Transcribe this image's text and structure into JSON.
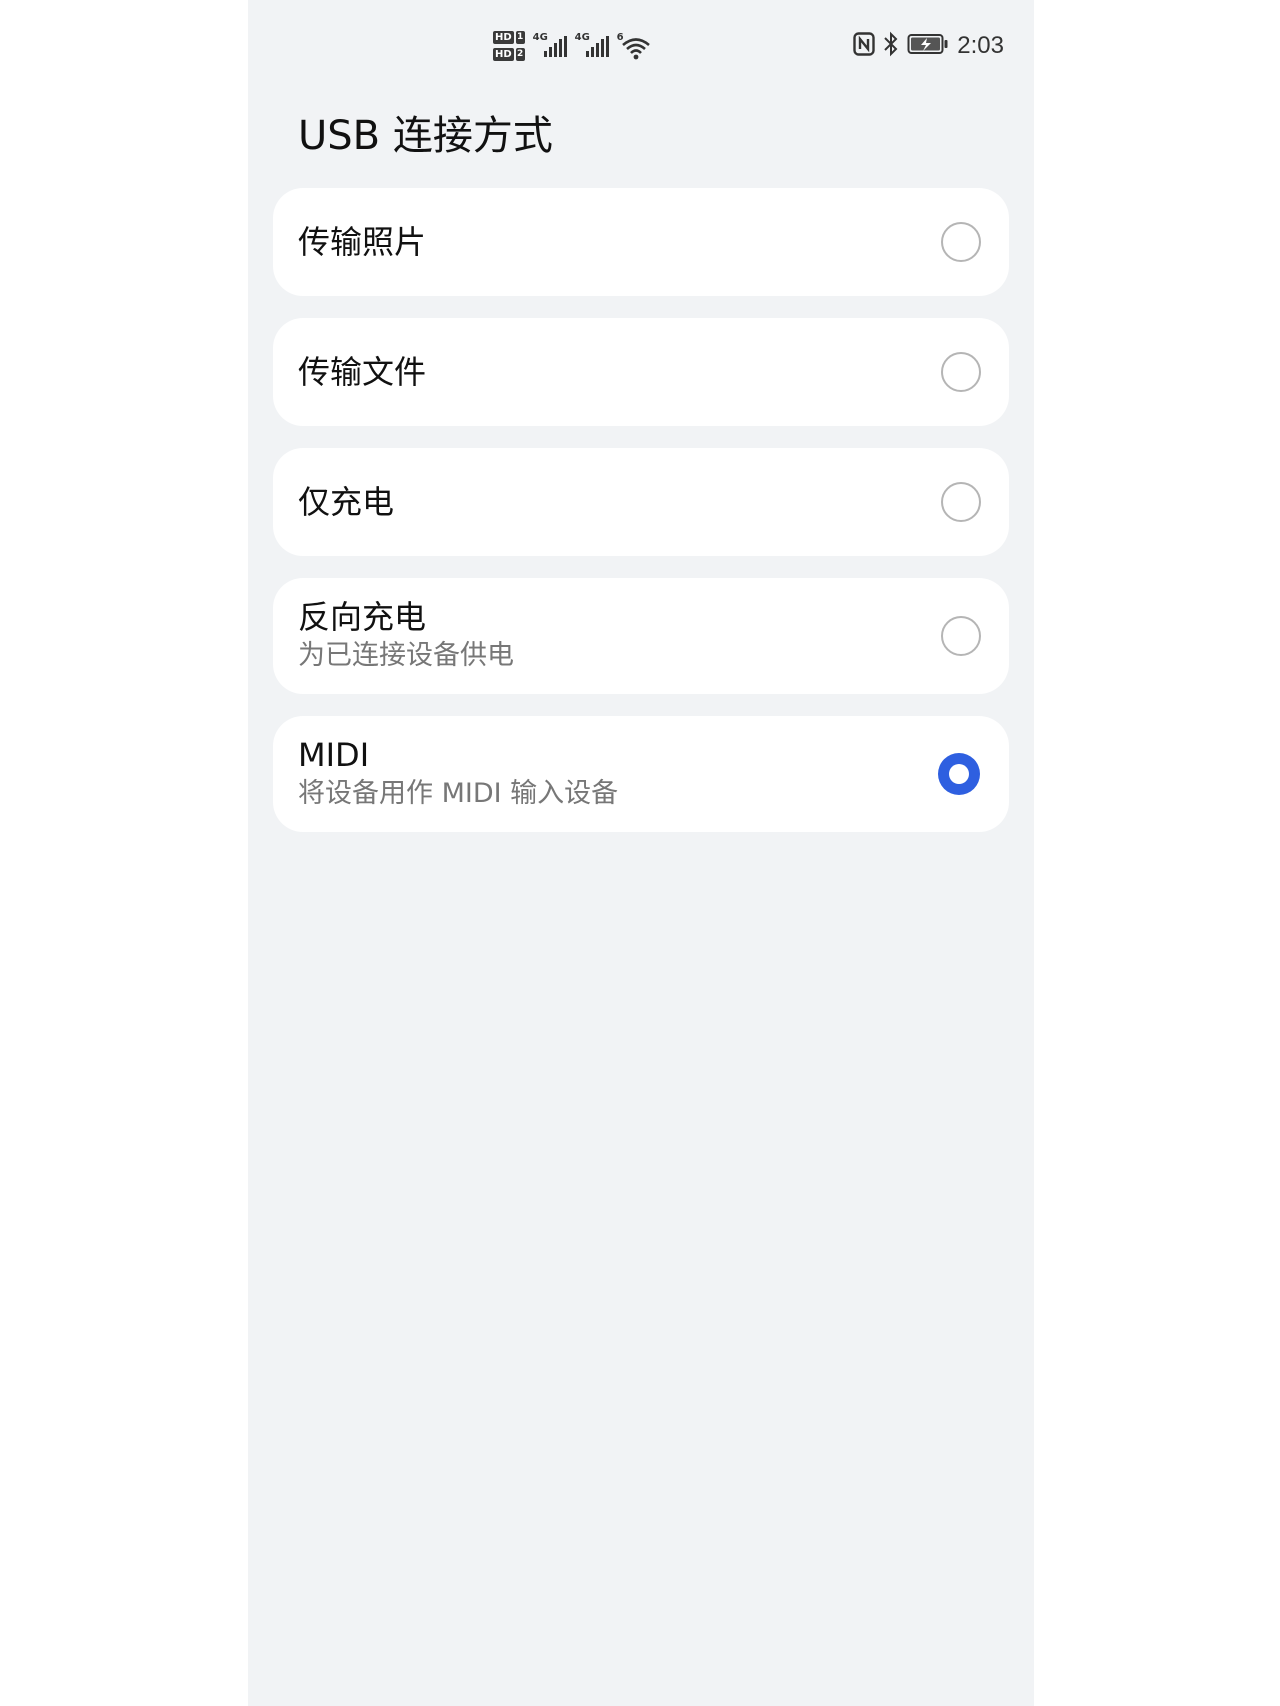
{
  "status_bar": {
    "hd1": "HD",
    "hd1_num": "1",
    "hd2": "HD",
    "hd2_num": "2",
    "signal1_gen": "4G",
    "signal2_gen": "4G",
    "wifi_gen": "6",
    "time": "2:03",
    "icons": [
      "hd-sim-icon",
      "signal-icon",
      "wifi-icon",
      "nfc-icon",
      "bluetooth-icon",
      "battery-charging-icon"
    ]
  },
  "page": {
    "title": "USB 连接方式"
  },
  "options": [
    {
      "label": "传输照片",
      "description": "",
      "selected": false
    },
    {
      "label": "传输文件",
      "description": "",
      "selected": false
    },
    {
      "label": "仅充电",
      "description": "",
      "selected": false
    },
    {
      "label": "反向充电",
      "description": "为已连接设备供电",
      "selected": false
    },
    {
      "label": "MIDI",
      "description": "将设备用作 MIDI 输入设备",
      "selected": true
    }
  ],
  "colors": {
    "accent": "#2e5fe0",
    "background": "#f1f3f5",
    "card": "#ffffff"
  }
}
